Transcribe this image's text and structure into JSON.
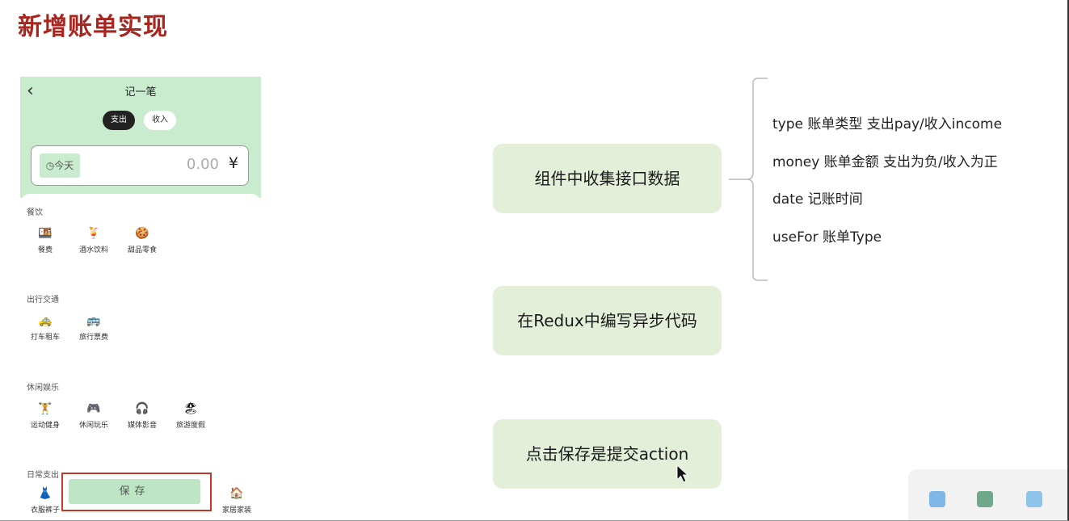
{
  "slide": {
    "title": "新增账单实现"
  },
  "phone": {
    "nav_title": "记一笔",
    "back_icon": "‹",
    "tabs": {
      "pay": "支出",
      "income": "收入"
    },
    "date_label": "今天",
    "amount": "0.00",
    "currency": "¥",
    "categories": [
      {
        "title": "餐饮",
        "items": [
          {
            "label": "餐费",
            "icon": "🍱"
          },
          {
            "label": "酒水饮料",
            "icon": "🍹"
          },
          {
            "label": "甜品零食",
            "icon": "🍪"
          }
        ]
      },
      {
        "title": "出行交通",
        "items": [
          {
            "label": "打车租车",
            "icon": "🚕"
          },
          {
            "label": "旅行票费",
            "icon": "🚌"
          }
        ]
      },
      {
        "title": "休闲娱乐",
        "items": [
          {
            "label": "运动健身",
            "icon": "🏋"
          },
          {
            "label": "休闲玩乐",
            "icon": "🎮"
          },
          {
            "label": "媒体影音",
            "icon": "🎧"
          },
          {
            "label": "旅游度假",
            "icon": "🏖"
          }
        ]
      },
      {
        "title": "日常支出",
        "items": [
          {
            "label": "衣服裤子",
            "icon": "👗"
          },
          {
            "label": "家居家装",
            "icon": "🏠"
          }
        ]
      }
    ],
    "save_label": "保存"
  },
  "flow": {
    "step1": "组件中收集接口数据",
    "step2": "在Redux中编写异步代码",
    "step3": "点击保存是提交action"
  },
  "fields": [
    "type  账单类型 支出pay/收入income",
    "money  账单金额  支出为负/收入为正",
    "date  记账时间",
    "useFor 账单Type"
  ]
}
